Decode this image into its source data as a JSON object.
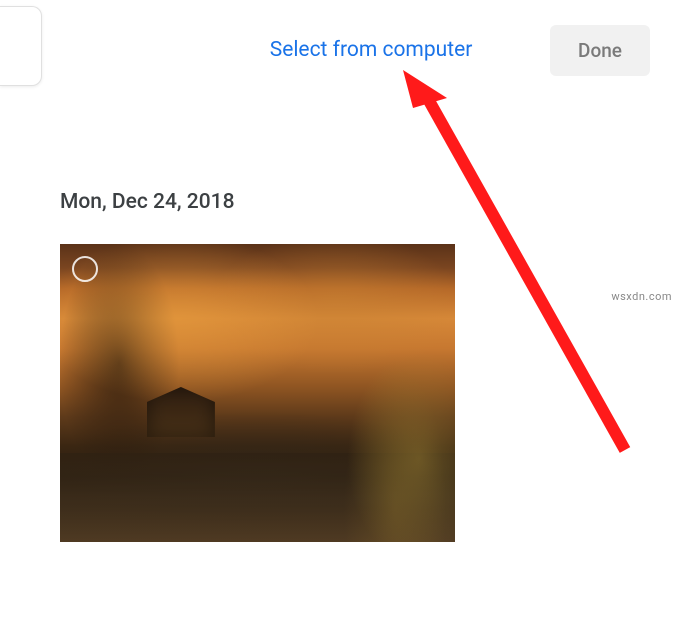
{
  "toolbar": {
    "select_from_computer_label": "Select from computer",
    "done_label": "Done"
  },
  "content": {
    "date_header": "Mon, Dec 24, 2018"
  },
  "watermark": "wsxdn.com",
  "annotation": {
    "arrow_color": "#ff1a1a"
  }
}
